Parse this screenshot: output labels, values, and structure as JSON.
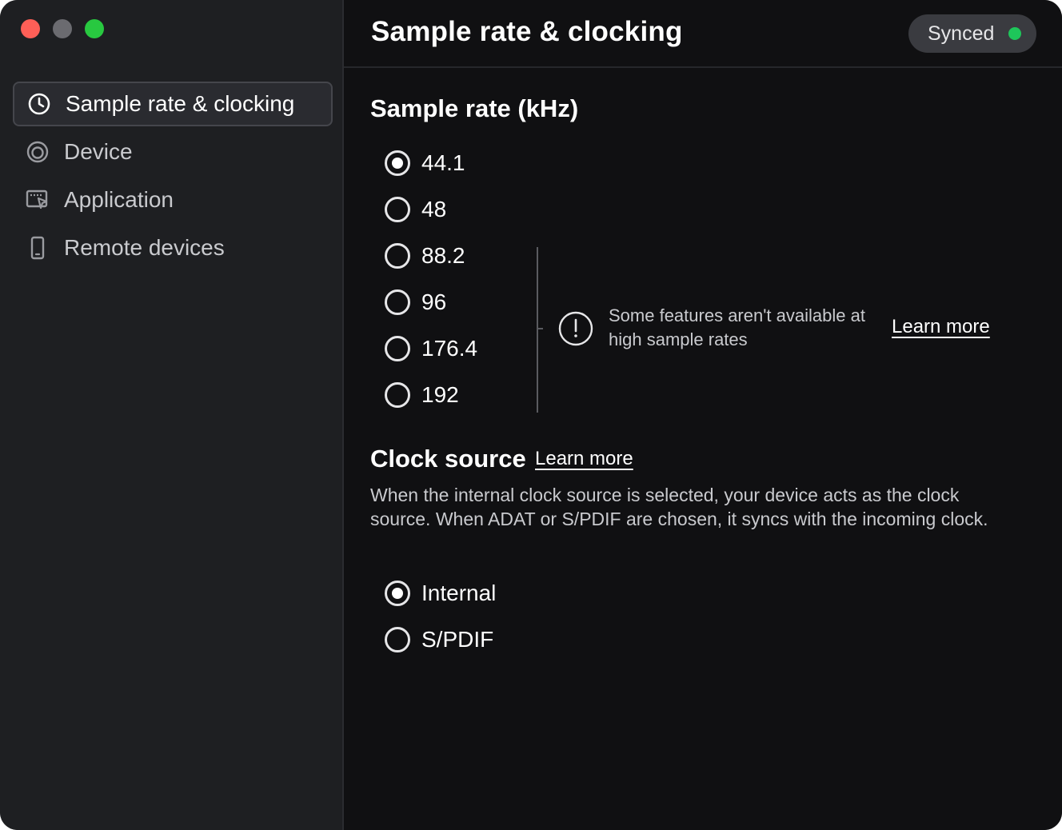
{
  "window": {
    "traffic_lights": {
      "close_color": "#ff5f57",
      "minimize_color": "#6b6b70",
      "zoom_color": "#28c840"
    }
  },
  "sidebar": {
    "items": [
      {
        "label": "Sample rate & clocking",
        "icon": "clock-icon",
        "active": true
      },
      {
        "label": "Device",
        "icon": "device-icon",
        "active": false
      },
      {
        "label": "Application",
        "icon": "application-icon",
        "active": false
      },
      {
        "label": "Remote devices",
        "icon": "phone-icon",
        "active": false
      }
    ]
  },
  "header": {
    "title": "Sample rate & clocking",
    "status": {
      "label": "Synced",
      "dot_color": "#1ec65a"
    }
  },
  "sample_rate": {
    "title": "Sample rate (kHz)",
    "options": [
      "44.1",
      "48",
      "88.2",
      "96",
      "176.4",
      "192"
    ],
    "selected": "44.1",
    "notice": {
      "text": "Some features aren't available at high sample rates",
      "link": "Learn more",
      "icon": "info-icon"
    }
  },
  "clock_source": {
    "title": "Clock source",
    "link": "Learn more",
    "description": "When the internal clock source is selected, your device acts as the clock source. When ADAT or S/PDIF are chosen, it syncs with the incoming clock.",
    "options": [
      "Internal",
      "S/PDIF"
    ],
    "selected": "Internal"
  }
}
